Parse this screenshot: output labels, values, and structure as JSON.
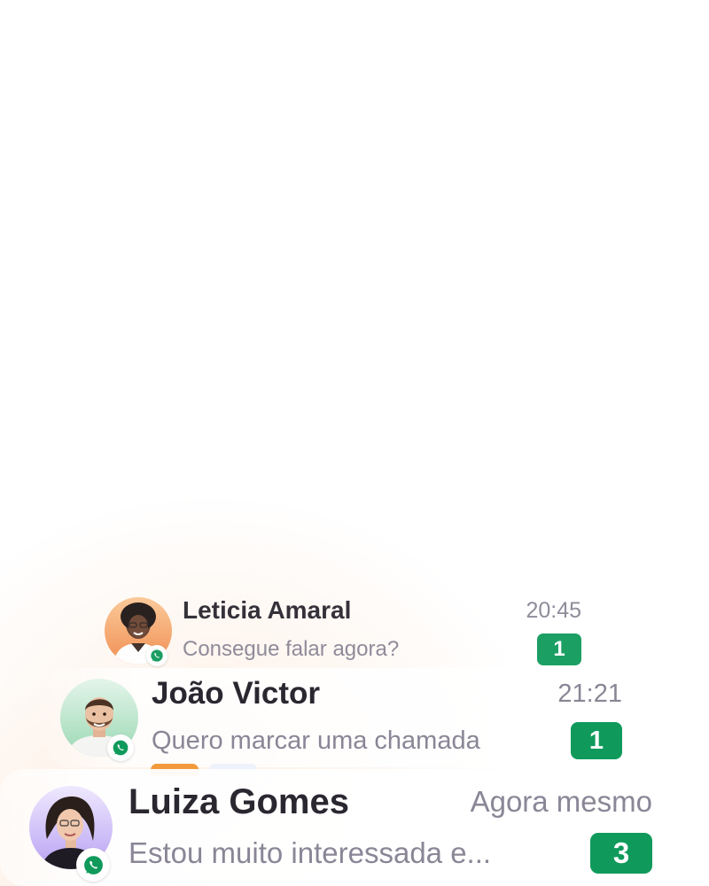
{
  "conversations": [
    {
      "name": "Leticia Amaral",
      "time": "20:45",
      "preview": "Consegue falar agora?",
      "unread": "1",
      "channel_icon": "whatsapp-icon",
      "avatar_bg": "#f3a46a"
    },
    {
      "name": "João Victor",
      "time": "21:21",
      "preview": "Quero marcar uma chamada",
      "unread": "1",
      "channel_icon": "whatsapp-icon",
      "avatar_bg": "#bfe6cf",
      "tag_colors": [
        "#f39a3c",
        "#eef2fb"
      ]
    },
    {
      "name": "Luiza Gomes",
      "time": "Agora mesmo",
      "preview": "Estou muito interessada e...",
      "unread": "3",
      "channel_icon": "whatsapp-icon",
      "avatar_bg": "#c9b8f5"
    }
  ],
  "colors": {
    "unread_badge": "#0f9a5b",
    "whatsapp": "#0f9a5b",
    "name_text": "#2b2730",
    "muted_text": "#8a8696"
  }
}
